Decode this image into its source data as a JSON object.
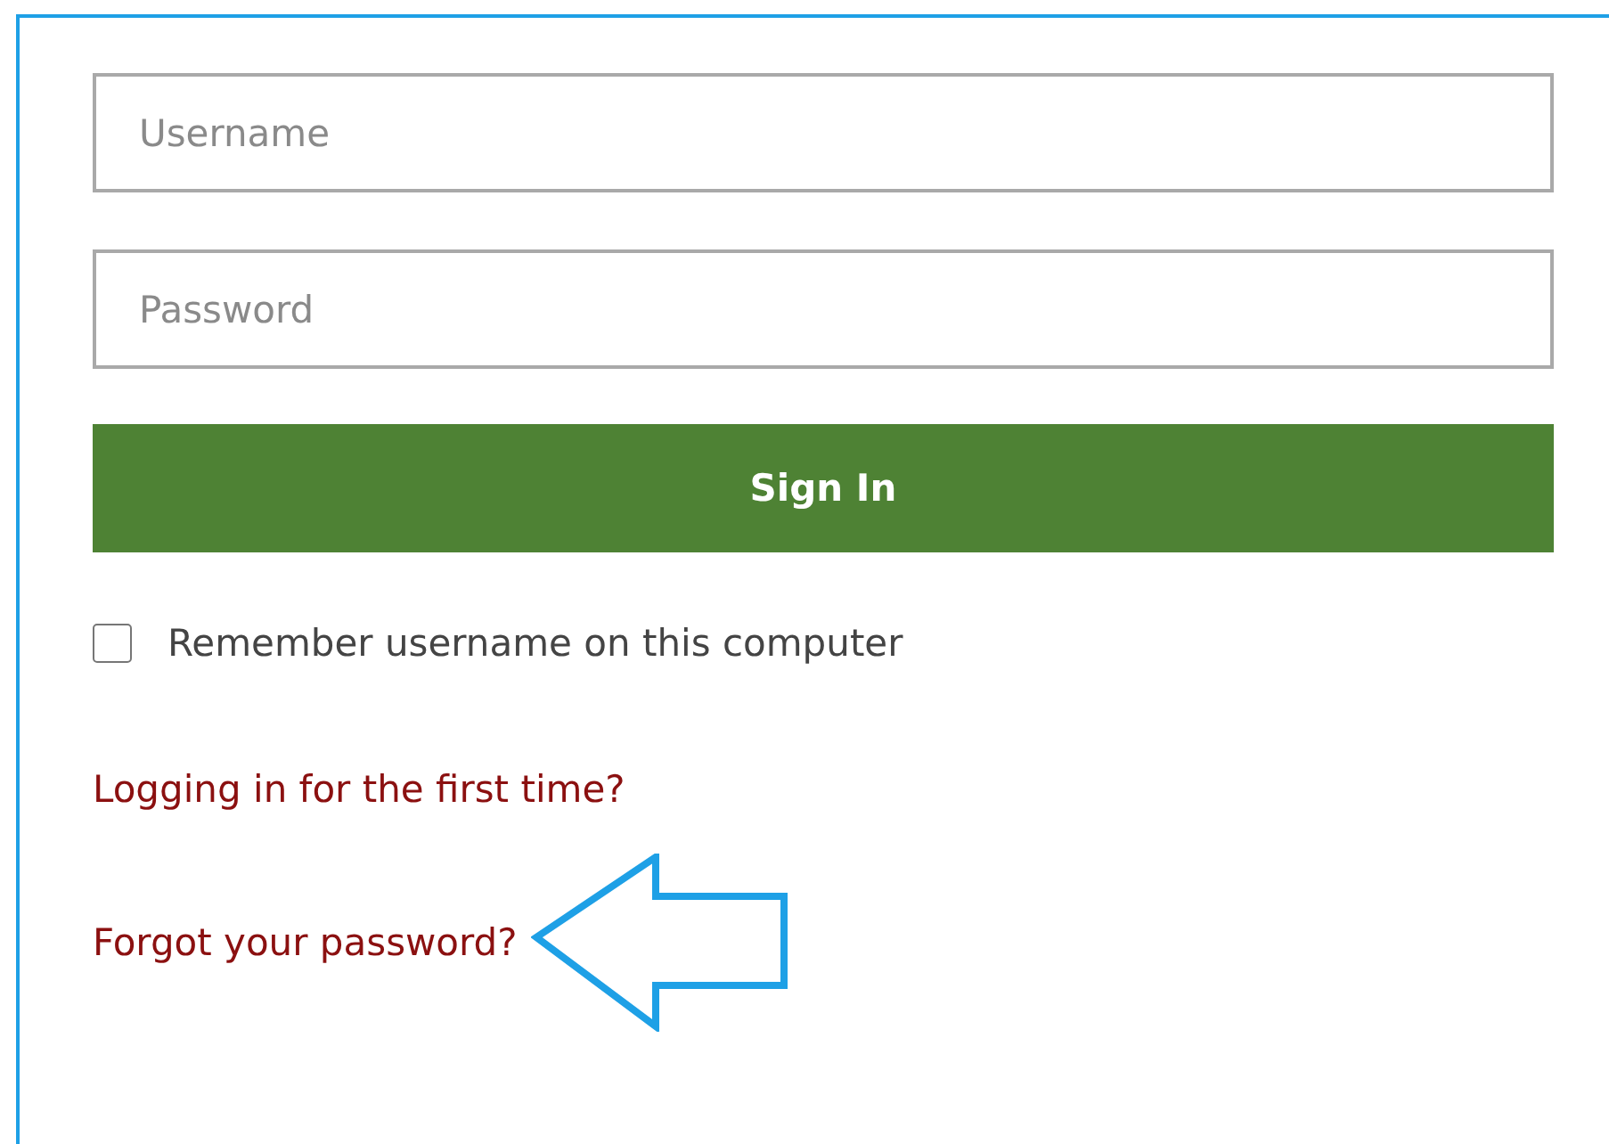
{
  "fields": [
    {
      "placeholder": "Username"
    },
    {
      "placeholder": "Password"
    }
  ],
  "sign_in_button": {
    "label": "Sign In"
  },
  "remember": {
    "label": "Remember username on this computer",
    "checked": false
  },
  "links": [
    {
      "label": "Logging in for the first time?",
      "highlighted": false
    },
    {
      "label": "Forgot your password?",
      "highlighted": true
    }
  ]
}
